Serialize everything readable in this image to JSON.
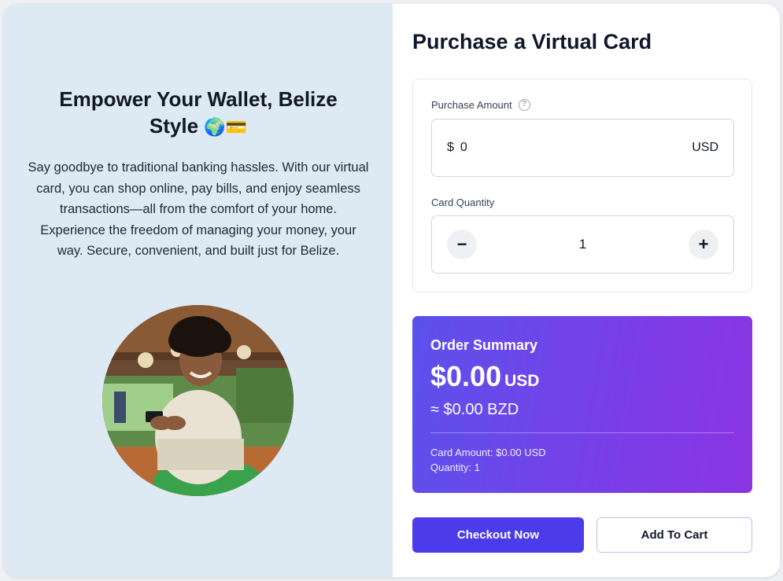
{
  "hero": {
    "headline": "Empower Your Wallet, Belize Style",
    "headline_emoji": "🌍💳",
    "description": "Say goodbye to traditional banking hassles. With our virtual card, you can shop online, pay bills, and enjoy seamless transactions—all from the comfort of your home. Experience the freedom of managing your money, your way. Secure, convenient, and built just for Belize."
  },
  "form": {
    "title": "Purchase a Virtual Card",
    "amount_label": "Purchase Amount",
    "help_icon": "help-circle-icon",
    "currency_symbol": "$",
    "amount_value": "0",
    "amount_unit": "USD",
    "quantity_label": "Card Quantity",
    "quantity_value": "1",
    "minus_symbol": "−",
    "plus_symbol": "+"
  },
  "summary": {
    "title": "Order Summary",
    "total": "$0.00",
    "total_unit": "USD",
    "bzd": "≈ $0.00 BZD",
    "card_amount": "Card Amount: $0.00 USD",
    "quantity": "Quantity: 1"
  },
  "actions": {
    "checkout": "Checkout Now",
    "add_to_cart": "Add To Cart"
  },
  "colors": {
    "left_panel_bg": "#dde9f3",
    "primary": "#4b3be8",
    "summary_gradient_start": "#5b51ec",
    "summary_gradient_end": "#8b34e3"
  }
}
